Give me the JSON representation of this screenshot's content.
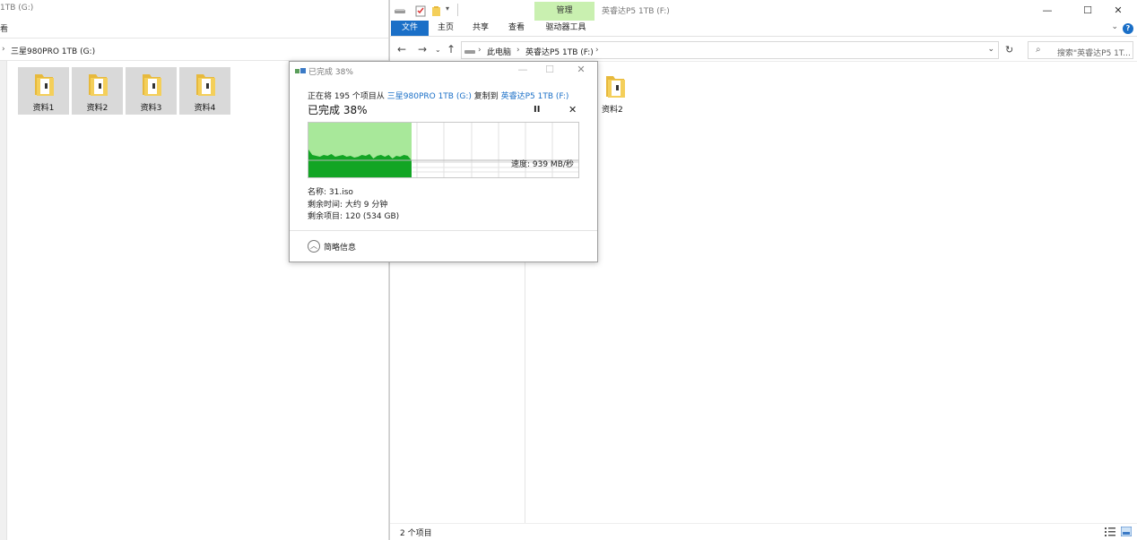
{
  "left_window": {
    "title": "1TB (G:)",
    "ribbon_fragment": "看",
    "address": "三星980PRO 1TB (G:)",
    "folders": [
      "资料1",
      "资料2",
      "资料3",
      "资料4"
    ]
  },
  "right_window": {
    "manage_tab": "管理",
    "title": "英睿达P5 1TB (F:)",
    "tabs": {
      "file": "文件",
      "home": "主页",
      "share": "共享",
      "view": "查看",
      "drive_tools": "驱动器工具"
    },
    "breadcrumb": [
      "此电脑",
      "英睿达P5 1TB (F:)"
    ],
    "search_placeholder": "搜索\"英睿达P5 1T...",
    "folder": "资料2",
    "status": "2 个项目",
    "window_controls": {
      "minimize": "—",
      "maximize": "☐",
      "close": "✕"
    },
    "help": "?"
  },
  "copy_dialog": {
    "title": "已完成 38%",
    "line_prefix": "正在将 195 个项目从 ",
    "source": "三星980PRO 1TB (G:)",
    "line_mid": " 复制到 ",
    "destination": "英睿达P5 1TB (F:)",
    "percent_label": "已完成 38%",
    "progress_fraction": 0.38,
    "speed": "速度: 939 MB/秒",
    "name": "名称: 31.iso",
    "time_remaining": "剩余时间: 大约 9 分钟",
    "items_remaining": "剩余项目: 120 (534 GB)",
    "less_details": "简略信息",
    "pause": "II",
    "cancel": "✕"
  },
  "colors": {
    "accent_blue": "#1a6fc7",
    "manage_tab_green": "#c9f0b0",
    "graph_light_green": "#a8e89a",
    "graph_dark_green": "#12a524",
    "folder_yellow": "#f4cf5a"
  }
}
